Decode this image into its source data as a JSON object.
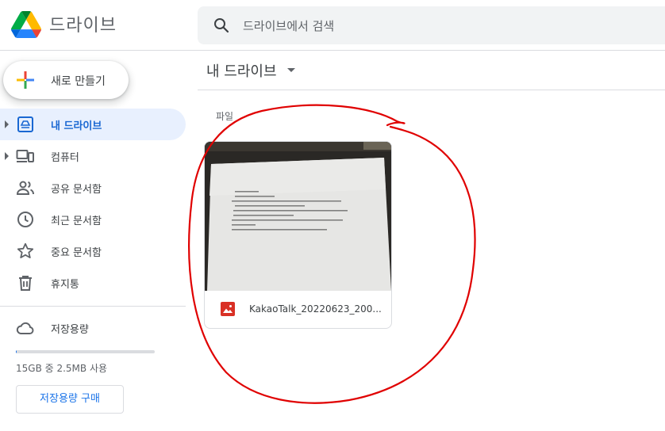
{
  "header": {
    "app_name": "드라이브",
    "search_placeholder": "드라이브에서 검색"
  },
  "sidebar": {
    "new_label": "새로 만들기",
    "items": [
      {
        "label": "내 드라이브",
        "icon": "my-drive-icon"
      },
      {
        "label": "컴퓨터",
        "icon": "computer-icon"
      },
      {
        "label": "공유 문서함",
        "icon": "shared-icon"
      },
      {
        "label": "최근 문서함",
        "icon": "clock-icon"
      },
      {
        "label": "중요 문서함",
        "icon": "star-icon"
      },
      {
        "label": "휴지통",
        "icon": "trash-icon"
      }
    ],
    "storage": {
      "label": "저장용량",
      "usage_text": "15GB 중 2.5MB 사용",
      "used_fraction": 0.0002,
      "buy_label": "저장용량 구매"
    }
  },
  "main": {
    "breadcrumb": "내 드라이브",
    "section_label": "파일",
    "files": [
      {
        "name": "KakaoTalk_20220623_200...",
        "type_icon": "image-file-icon"
      }
    ]
  },
  "colors": {
    "accent": "#1a73e8",
    "active_bg": "#e8f0fe",
    "annotation": "#e00000",
    "file_icon": "#d93025"
  }
}
